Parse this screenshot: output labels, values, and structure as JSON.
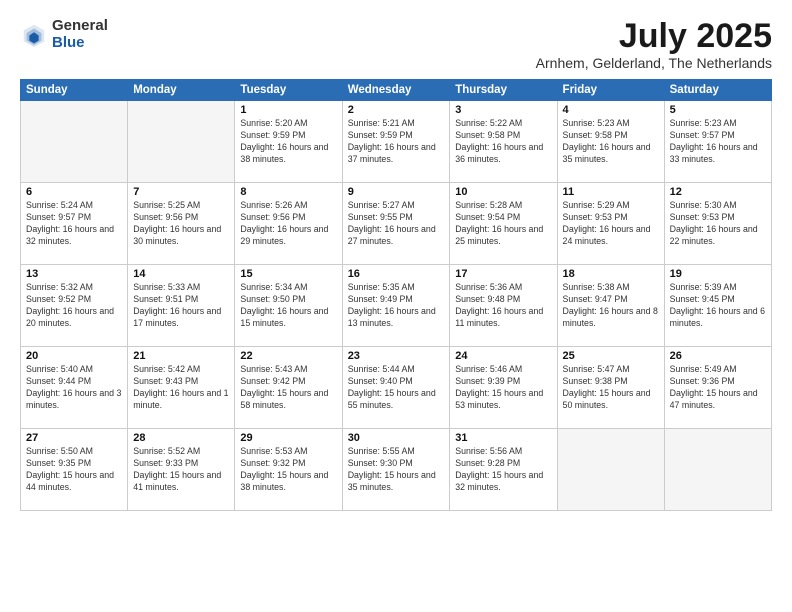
{
  "logo": {
    "general": "General",
    "blue": "Blue"
  },
  "title": "July 2025",
  "location": "Arnhem, Gelderland, The Netherlands",
  "days_header": [
    "Sunday",
    "Monday",
    "Tuesday",
    "Wednesday",
    "Thursday",
    "Friday",
    "Saturday"
  ],
  "weeks": [
    [
      {
        "day": "",
        "sunrise": "",
        "sunset": "",
        "daylight": ""
      },
      {
        "day": "",
        "sunrise": "",
        "sunset": "",
        "daylight": ""
      },
      {
        "day": "1",
        "sunrise": "Sunrise: 5:20 AM",
        "sunset": "Sunset: 9:59 PM",
        "daylight": "Daylight: 16 hours and 38 minutes."
      },
      {
        "day": "2",
        "sunrise": "Sunrise: 5:21 AM",
        "sunset": "Sunset: 9:59 PM",
        "daylight": "Daylight: 16 hours and 37 minutes."
      },
      {
        "day": "3",
        "sunrise": "Sunrise: 5:22 AM",
        "sunset": "Sunset: 9:58 PM",
        "daylight": "Daylight: 16 hours and 36 minutes."
      },
      {
        "day": "4",
        "sunrise": "Sunrise: 5:23 AM",
        "sunset": "Sunset: 9:58 PM",
        "daylight": "Daylight: 16 hours and 35 minutes."
      },
      {
        "day": "5",
        "sunrise": "Sunrise: 5:23 AM",
        "sunset": "Sunset: 9:57 PM",
        "daylight": "Daylight: 16 hours and 33 minutes."
      }
    ],
    [
      {
        "day": "6",
        "sunrise": "Sunrise: 5:24 AM",
        "sunset": "Sunset: 9:57 PM",
        "daylight": "Daylight: 16 hours and 32 minutes."
      },
      {
        "day": "7",
        "sunrise": "Sunrise: 5:25 AM",
        "sunset": "Sunset: 9:56 PM",
        "daylight": "Daylight: 16 hours and 30 minutes."
      },
      {
        "day": "8",
        "sunrise": "Sunrise: 5:26 AM",
        "sunset": "Sunset: 9:56 PM",
        "daylight": "Daylight: 16 hours and 29 minutes."
      },
      {
        "day": "9",
        "sunrise": "Sunrise: 5:27 AM",
        "sunset": "Sunset: 9:55 PM",
        "daylight": "Daylight: 16 hours and 27 minutes."
      },
      {
        "day": "10",
        "sunrise": "Sunrise: 5:28 AM",
        "sunset": "Sunset: 9:54 PM",
        "daylight": "Daylight: 16 hours and 25 minutes."
      },
      {
        "day": "11",
        "sunrise": "Sunrise: 5:29 AM",
        "sunset": "Sunset: 9:53 PM",
        "daylight": "Daylight: 16 hours and 24 minutes."
      },
      {
        "day": "12",
        "sunrise": "Sunrise: 5:30 AM",
        "sunset": "Sunset: 9:53 PM",
        "daylight": "Daylight: 16 hours and 22 minutes."
      }
    ],
    [
      {
        "day": "13",
        "sunrise": "Sunrise: 5:32 AM",
        "sunset": "Sunset: 9:52 PM",
        "daylight": "Daylight: 16 hours and 20 minutes."
      },
      {
        "day": "14",
        "sunrise": "Sunrise: 5:33 AM",
        "sunset": "Sunset: 9:51 PM",
        "daylight": "Daylight: 16 hours and 17 minutes."
      },
      {
        "day": "15",
        "sunrise": "Sunrise: 5:34 AM",
        "sunset": "Sunset: 9:50 PM",
        "daylight": "Daylight: 16 hours and 15 minutes."
      },
      {
        "day": "16",
        "sunrise": "Sunrise: 5:35 AM",
        "sunset": "Sunset: 9:49 PM",
        "daylight": "Daylight: 16 hours and 13 minutes."
      },
      {
        "day": "17",
        "sunrise": "Sunrise: 5:36 AM",
        "sunset": "Sunset: 9:48 PM",
        "daylight": "Daylight: 16 hours and 11 minutes."
      },
      {
        "day": "18",
        "sunrise": "Sunrise: 5:38 AM",
        "sunset": "Sunset: 9:47 PM",
        "daylight": "Daylight: 16 hours and 8 minutes."
      },
      {
        "day": "19",
        "sunrise": "Sunrise: 5:39 AM",
        "sunset": "Sunset: 9:45 PM",
        "daylight": "Daylight: 16 hours and 6 minutes."
      }
    ],
    [
      {
        "day": "20",
        "sunrise": "Sunrise: 5:40 AM",
        "sunset": "Sunset: 9:44 PM",
        "daylight": "Daylight: 16 hours and 3 minutes."
      },
      {
        "day": "21",
        "sunrise": "Sunrise: 5:42 AM",
        "sunset": "Sunset: 9:43 PM",
        "daylight": "Daylight: 16 hours and 1 minute."
      },
      {
        "day": "22",
        "sunrise": "Sunrise: 5:43 AM",
        "sunset": "Sunset: 9:42 PM",
        "daylight": "Daylight: 15 hours and 58 minutes."
      },
      {
        "day": "23",
        "sunrise": "Sunrise: 5:44 AM",
        "sunset": "Sunset: 9:40 PM",
        "daylight": "Daylight: 15 hours and 55 minutes."
      },
      {
        "day": "24",
        "sunrise": "Sunrise: 5:46 AM",
        "sunset": "Sunset: 9:39 PM",
        "daylight": "Daylight: 15 hours and 53 minutes."
      },
      {
        "day": "25",
        "sunrise": "Sunrise: 5:47 AM",
        "sunset": "Sunset: 9:38 PM",
        "daylight": "Daylight: 15 hours and 50 minutes."
      },
      {
        "day": "26",
        "sunrise": "Sunrise: 5:49 AM",
        "sunset": "Sunset: 9:36 PM",
        "daylight": "Daylight: 15 hours and 47 minutes."
      }
    ],
    [
      {
        "day": "27",
        "sunrise": "Sunrise: 5:50 AM",
        "sunset": "Sunset: 9:35 PM",
        "daylight": "Daylight: 15 hours and 44 minutes."
      },
      {
        "day": "28",
        "sunrise": "Sunrise: 5:52 AM",
        "sunset": "Sunset: 9:33 PM",
        "daylight": "Daylight: 15 hours and 41 minutes."
      },
      {
        "day": "29",
        "sunrise": "Sunrise: 5:53 AM",
        "sunset": "Sunset: 9:32 PM",
        "daylight": "Daylight: 15 hours and 38 minutes."
      },
      {
        "day": "30",
        "sunrise": "Sunrise: 5:55 AM",
        "sunset": "Sunset: 9:30 PM",
        "daylight": "Daylight: 15 hours and 35 minutes."
      },
      {
        "day": "31",
        "sunrise": "Sunrise: 5:56 AM",
        "sunset": "Sunset: 9:28 PM",
        "daylight": "Daylight: 15 hours and 32 minutes."
      },
      {
        "day": "",
        "sunrise": "",
        "sunset": "",
        "daylight": ""
      },
      {
        "day": "",
        "sunrise": "",
        "sunset": "",
        "daylight": ""
      }
    ]
  ]
}
